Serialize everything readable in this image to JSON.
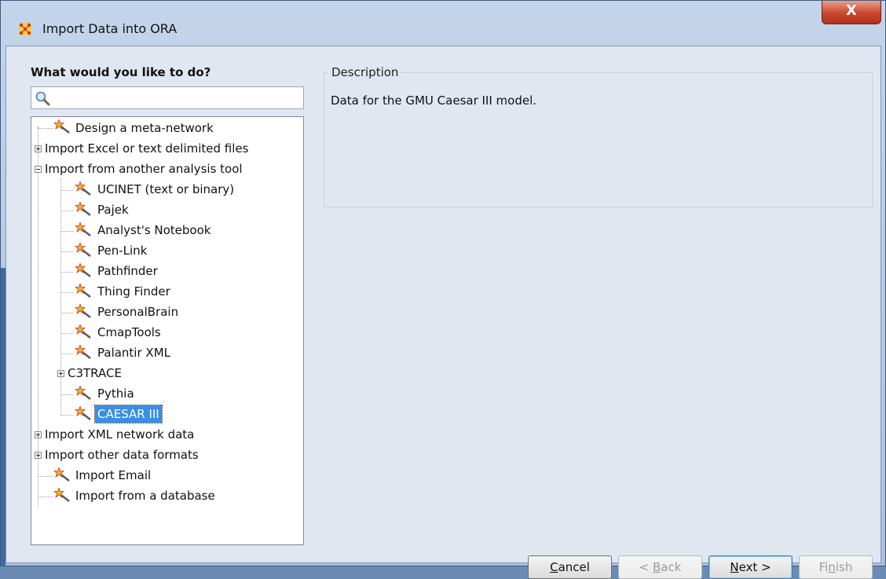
{
  "window": {
    "title": "Import Data into ORA",
    "close_symbol": "X"
  },
  "left_panel": {
    "prompt": "What would you like to do?",
    "search": {
      "value": "",
      "placeholder": ""
    }
  },
  "tree": {
    "items": [
      {
        "label": "Design a meta-network"
      },
      {
        "label": "Import Excel or text delimited files"
      },
      {
        "label": "Import from another analysis tool"
      },
      {
        "label": "UCINET (text or binary)"
      },
      {
        "label": "Pajek"
      },
      {
        "label": "Analyst's Notebook"
      },
      {
        "label": "Pen-Link"
      },
      {
        "label": "Pathfinder"
      },
      {
        "label": "Thing Finder"
      },
      {
        "label": "PersonalBrain"
      },
      {
        "label": "CmapTools"
      },
      {
        "label": "Palantir XML"
      },
      {
        "label": "C3TRACE"
      },
      {
        "label": "Pythia"
      },
      {
        "label": "CAESAR III"
      },
      {
        "label": "Import XML network data"
      },
      {
        "label": "Import other data formats"
      },
      {
        "label": "Import Email"
      },
      {
        "label": "Import from a database"
      }
    ],
    "selected_label": "CAESAR III"
  },
  "description": {
    "legend": "Description",
    "text": "Data for the GMU Caesar III model."
  },
  "buttons": {
    "cancel": {
      "label": "Cancel",
      "mnemonic": "C",
      "rest": "ancel"
    },
    "back": {
      "label": "< Back",
      "prefix": "< ",
      "mnemonic": "B",
      "rest": "ack"
    },
    "next": {
      "label": "Next >",
      "mnemonic": "N",
      "rest": "ext >"
    },
    "finish": {
      "label": "Finish",
      "prefix": "Fi",
      "mnemonic": "n",
      "rest": "ish"
    }
  },
  "colors": {
    "selection": "#3a8ee6",
    "titlebar": "#b7cbe6",
    "close_button": "#c8462c"
  }
}
